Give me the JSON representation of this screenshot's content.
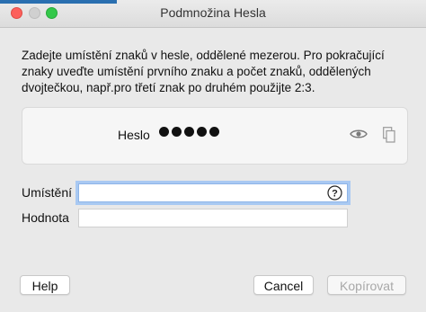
{
  "window": {
    "title": "Podmnožina Hesla"
  },
  "colors": {
    "accent": "#2a6fb0",
    "focus_ring": "#a9c9f2"
  },
  "instructions": "Zadejte umístění znaků v hesle, oddělené mezerou. Pro pokračující znaky uveďte umístění prvního znaku a počet znaků, oddělených dvojtečkou, např.pro třetí znak po druhém použijte 2:3.",
  "password_card": {
    "label": "Heslo",
    "masked_length": 5,
    "icons": [
      "eye-icon",
      "copy-icon"
    ]
  },
  "fields": {
    "position": {
      "label": "Umístění",
      "value": ""
    },
    "value": {
      "label": "Hodnota",
      "value": ""
    }
  },
  "buttons": {
    "help": "Help",
    "cancel": "Cancel",
    "copy": "Kopírovat"
  }
}
